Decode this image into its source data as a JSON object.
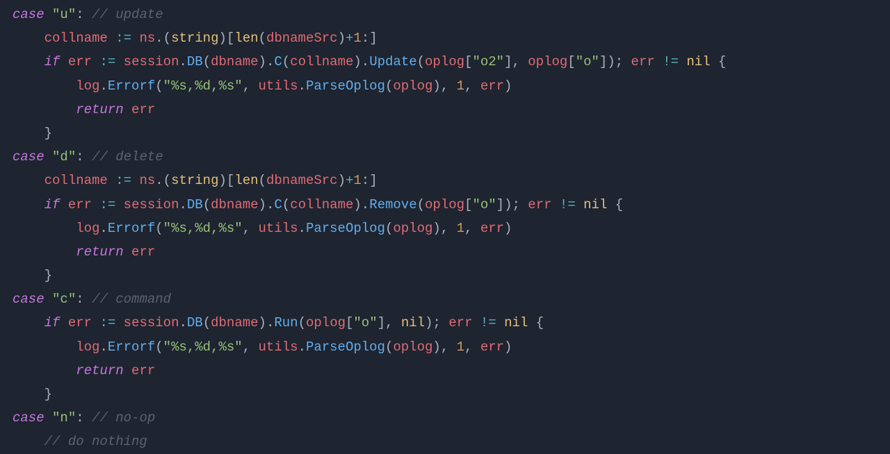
{
  "code": {
    "case_u": {
      "kw": "case",
      "str": "\"u\"",
      "colon": ":",
      "cmt": "// update"
    },
    "line_coll_u": {
      "lhs": "collname",
      "op": ":=",
      "ns": "ns",
      "dot1": ".",
      "paren_o": "(",
      "typ": "string",
      "paren_c": ")",
      "brk_o": "[",
      "len": "len",
      "paren2_o": "(",
      "dbnameSrc": "dbnameSrc",
      "paren2_c": ")",
      "plus": "+",
      "one": "1",
      "colon": ":",
      "brk_c": "]"
    },
    "line_if_u": {
      "kw_if": "if",
      "err": "err",
      "op": ":=",
      "session": "session",
      "dot1": ".",
      "DB": "DB",
      "po1": "(",
      "dbname": "dbname",
      "pc1": ")",
      "dot2": ".",
      "C": "C",
      "po2": "(",
      "collname": "collname",
      "pc2": ")",
      "dot3": ".",
      "Update": "Update",
      "po3": "(",
      "oplog1": "oplog",
      "bo1": "[",
      "s_o2": "\"o2\"",
      "bc1": "]",
      "comma1": ",",
      "sp1": " ",
      "oplog2": "oplog",
      "bo2": "[",
      "s_o": "\"o\"",
      "bc2": "]",
      "pc3": ")",
      "semi": ";",
      "sp2": " ",
      "err2": "err",
      "neq": "!=",
      "nil": "nil",
      "brace_o": "{"
    },
    "line_log": {
      "log": "log",
      "dot": ".",
      "Errorf": "Errorf",
      "po": "(",
      "fmt": "\"%s,%d,%s\"",
      "comma1": ",",
      "utils": "utils",
      "dot2": ".",
      "ParseOplog": "ParseOplog",
      "po2": "(",
      "oplog": "oplog",
      "pc2": ")",
      "comma2": ",",
      "one": "1",
      "comma3": ",",
      "err": "err",
      "pc": ")"
    },
    "line_ret": {
      "kw": "return",
      "err": "err"
    },
    "brace_c": "}",
    "case_d": {
      "kw": "case",
      "str": "\"d\"",
      "colon": ":",
      "cmt": "// delete"
    },
    "line_if_d": {
      "kw_if": "if",
      "err": "err",
      "op": ":=",
      "session": "session",
      "dot1": ".",
      "DB": "DB",
      "po1": "(",
      "dbname": "dbname",
      "pc1": ")",
      "dot2": ".",
      "C": "C",
      "po2": "(",
      "collname": "collname",
      "pc2": ")",
      "dot3": ".",
      "Remove": "Remove",
      "po3": "(",
      "oplog": "oplog",
      "bo": "[",
      "s_o": "\"o\"",
      "bc": "]",
      "pc3": ")",
      "semi": ";",
      "err2": "err",
      "neq": "!=",
      "nil": "nil",
      "brace_o": "{"
    },
    "case_c": {
      "kw": "case",
      "str": "\"c\"",
      "colon": ":",
      "cmt": "// command"
    },
    "line_if_c": {
      "kw_if": "if",
      "err": "err",
      "op": ":=",
      "session": "session",
      "dot1": ".",
      "DB": "DB",
      "po1": "(",
      "dbname": "dbname",
      "pc1": ")",
      "dot2": ".",
      "Run": "Run",
      "po2": "(",
      "oplog": "oplog",
      "bo": "[",
      "s_o": "\"o\"",
      "bc": "]",
      "comma": ",",
      "nil1": "nil",
      "pc2": ")",
      "semi": ";",
      "err2": "err",
      "neq": "!=",
      "nil2": "nil",
      "brace_o": "{"
    },
    "case_n": {
      "kw": "case",
      "str": "\"n\"",
      "colon": ":",
      "cmt": "// no-op"
    },
    "line_nothing": {
      "cmt": "// do nothing"
    }
  }
}
